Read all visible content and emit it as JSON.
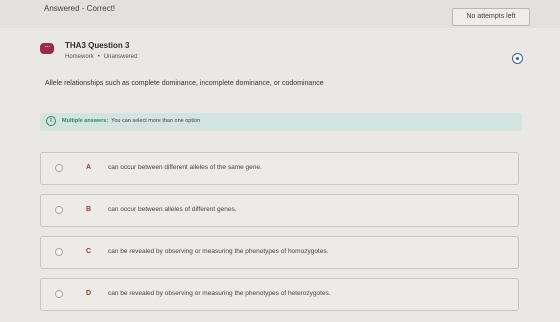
{
  "header": {
    "status": "Answered - Correct!",
    "attempts": "No attempts left"
  },
  "question": {
    "title": "THA3 Question 3",
    "category": "Homework",
    "state": "Unanswered",
    "prompt": "Allele relationships such as complete dominance, incomplete dominance, or codominance"
  },
  "info": {
    "label": "Multiple answers:",
    "text": "You can select more than one option"
  },
  "options": [
    {
      "letter": "A",
      "text": "can occur between different alleles of the same gene."
    },
    {
      "letter": "B",
      "text": "can occur between alleles of different genes."
    },
    {
      "letter": "C",
      "text": "can be revealed by observing or measuring the phenotypes of homozygotes."
    },
    {
      "letter": "D",
      "text": "can be revealed by observing or measuring the phenotypes of heterozygotes."
    }
  ],
  "icons": {
    "question": "chat-bubble-icon",
    "flag": "radio-flag-icon",
    "info": "info-icon"
  },
  "colors": {
    "accent": "#9c2b4a",
    "info_green": "#2f8a63",
    "option_letter": "#a33a2a"
  }
}
